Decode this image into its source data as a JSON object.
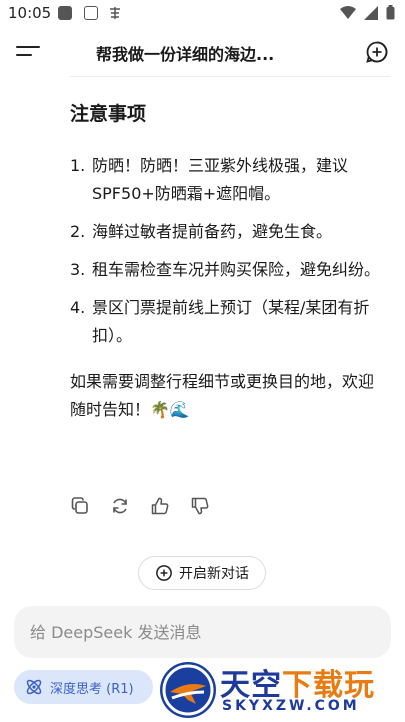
{
  "status_bar": {
    "time": "10:05"
  },
  "header": {
    "title": "帮我做一份详细的海边..."
  },
  "section": {
    "title": "注意事项"
  },
  "notes": [
    {
      "num": "1.",
      "text": "防晒！防晒！三亚紫外线极强，建议SPF50+防晒霜+遮阳帽。"
    },
    {
      "num": "2.",
      "text": "海鲜过敏者提前备药，避免生食。"
    },
    {
      "num": "3.",
      "text": "租车需检查车况并购买保险，避免纠纷。"
    },
    {
      "num": "4.",
      "text": "景区门票提前线上预订（某程/某团有折扣）。"
    }
  ],
  "closing": "如果需要调整行程细节或更换目的地，欢迎随时告知！🌴🌊",
  "new_chat_label": "开启新对话",
  "input": {
    "placeholder": "给 DeepSeek 发送消息"
  },
  "deep_think_label": "深度思考 (R1)",
  "watermark": {
    "title_a": "天空",
    "title_b": "下载玩",
    "sub": "SKYXZW.COM"
  },
  "colors": {
    "accent": "#3b62c4",
    "deep_bg": "#dbe6fb",
    "watermark_blue": "#1e3a9c",
    "watermark_orange": "#e87c13"
  }
}
